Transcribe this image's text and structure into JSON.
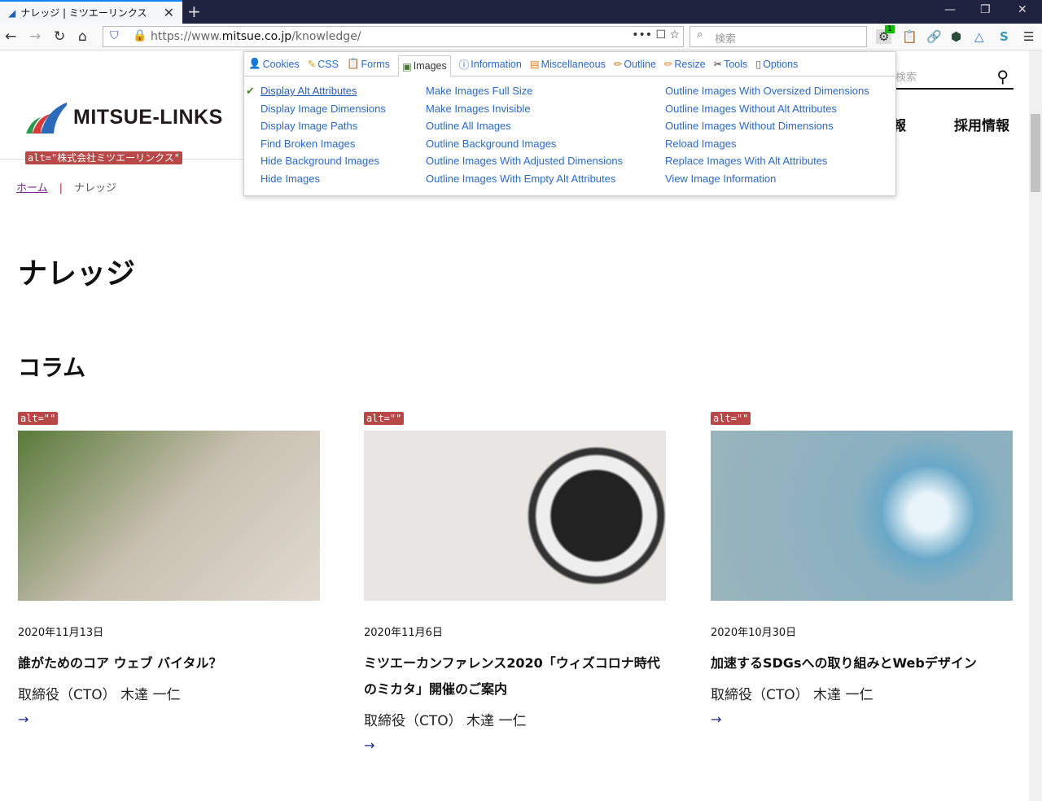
{
  "browser": {
    "tab_title": "ナレッジ | ミツエーリンクス",
    "url_prefix": "https://www.",
    "url_domain": "mitsue.co.jp",
    "url_path": "/knowledge/",
    "search_placeholder": "検索",
    "ext_badge": "1"
  },
  "site": {
    "logo_text": "MITSUE-LINKS",
    "logo_alt": "alt=\"株式会社ミツエーリンクス\"",
    "search_placeholder": "検索",
    "nav": [
      "報",
      "採用情報"
    ]
  },
  "breadcrumb": {
    "home": "ホーム",
    "current": "ナレッジ"
  },
  "page_title": "ナレッジ",
  "section_title": "コラム",
  "cards": [
    {
      "alt": "alt=\"\"",
      "date": "2020年11月13日",
      "title": "誰がためのコア ウェブ バイタル？",
      "author": "取締役（CTO） 木達 一仁",
      "arrow": "→"
    },
    {
      "alt": "alt=\"\"",
      "date": "2020年11月6日",
      "title": "ミツエーカンファレンス2020「ウィズコロナ時代のミカタ」開催のご案内",
      "author": "取締役（CTO） 木達 一仁",
      "arrow": "→"
    },
    {
      "alt": "alt=\"\"",
      "date": "2020年10月30日",
      "title": "加速するSDGsへの取り組みとWebデザイン",
      "author": "取締役（CTO） 木達 一仁",
      "arrow": "→"
    }
  ],
  "devtools": {
    "tabs": [
      "Cookies",
      "CSS",
      "Forms",
      "Images",
      "Information",
      "Miscellaneous",
      "Outline",
      "Resize",
      "Tools",
      "Options"
    ],
    "active_tab": "Images",
    "col1": [
      "Display Alt Attributes",
      "Display Image Dimensions",
      "Display Image Paths",
      "Find Broken Images",
      "Hide Background Images",
      "Hide Images"
    ],
    "col2": [
      "Make Images Full Size",
      "Make Images Invisible",
      "Outline All Images",
      "Outline Background Images",
      "Outline Images With Adjusted Dimensions",
      "Outline Images With Empty Alt Attributes"
    ],
    "col3": [
      "Outline Images With Oversized Dimensions",
      "Outline Images Without Alt Attributes",
      "Outline Images Without Dimensions",
      "Reload Images",
      "Replace Images With Alt Attributes",
      "View Image Information"
    ],
    "checked": "Display Alt Attributes"
  }
}
